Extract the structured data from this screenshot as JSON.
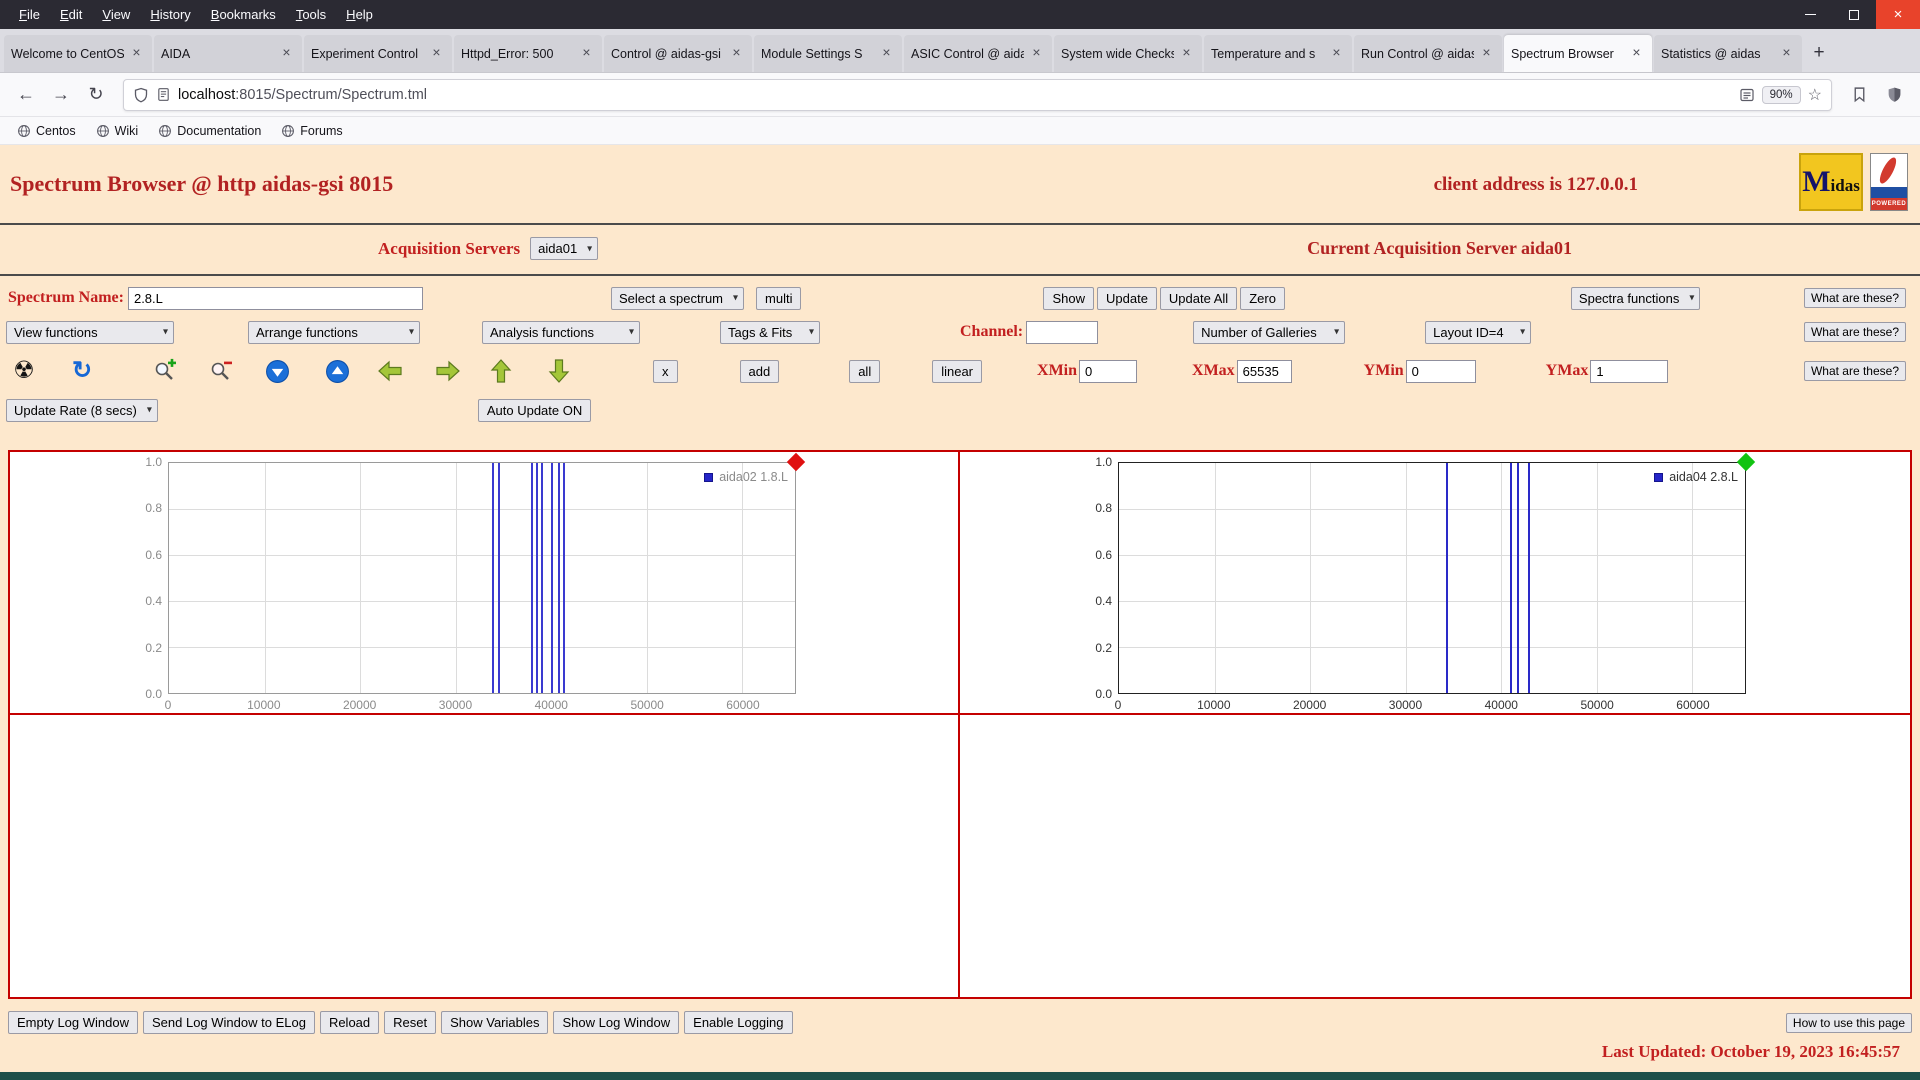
{
  "colors": {
    "page_bg": "#fde8cd",
    "heading_red": "#b22222",
    "label_red": "#c22020",
    "grid_border": "#c40000"
  },
  "glyphs": {
    "close": "×",
    "new_tab": "+",
    "back": "←",
    "forward": "→",
    "reload": "↻",
    "star": "☆",
    "radiation": "☢",
    "refresh": "↻"
  },
  "browser": {
    "menu_items": [
      "File",
      "Edit",
      "View",
      "History",
      "Bookmarks",
      "Tools",
      "Help"
    ],
    "tabs": [
      {
        "label": "Welcome to CentOS",
        "active": false
      },
      {
        "label": "AIDA",
        "active": false
      },
      {
        "label": "Experiment Control",
        "active": false
      },
      {
        "label": "Httpd_Error: 500",
        "active": false
      },
      {
        "label": "Control @ aidas-gsi",
        "active": false
      },
      {
        "label": "Module Settings S",
        "active": false
      },
      {
        "label": "ASIC Control @ aidas",
        "active": false
      },
      {
        "label": "System wide Checks",
        "active": false
      },
      {
        "label": "Temperature and s",
        "active": false
      },
      {
        "label": "Run Control @ aidas",
        "active": false
      },
      {
        "label": "Spectrum Browser",
        "active": true
      },
      {
        "label": "Statistics @ aidas",
        "active": false
      }
    ],
    "url": {
      "host": "localhost",
      "path": ":8015/Spectrum/Spectrum.tml"
    },
    "zoom_level": "90%",
    "bookmarks": [
      "Centos",
      "Wiki",
      "Documentation",
      "Forums"
    ]
  },
  "page": {
    "header": {
      "title": "Spectrum Browser @ http aidas-gsi 8015",
      "client_address": "client address is 127.0.0.1",
      "midas_logo_text": "Midas",
      "tcl_logo_text": "POWERED"
    },
    "acquisition": {
      "label": "Acquisition Servers",
      "selected": "aida01",
      "current": "Current Acquisition Server aida01"
    },
    "controls": {
      "spectrum_name_label": "Spectrum Name:",
      "spectrum_name_value": "2.8.L",
      "select_spectrum": "Select a spectrum",
      "multi": "multi",
      "show": "Show",
      "update": "Update",
      "update_all": "Update All",
      "zero": "Zero",
      "spectra_functions": "Spectra functions",
      "what_are_these": "What are these?",
      "view_functions": "View functions",
      "arrange_functions": "Arrange functions",
      "analysis_functions": "Analysis functions",
      "tags_fits": "Tags & Fits",
      "channel_label": "Channel:",
      "channel_value": "",
      "number_of_galleries": "Number of Galleries",
      "layout_id": "Layout ID=4",
      "x_button": "x",
      "add": "add",
      "all": "all",
      "linear": "linear",
      "xmin_label": "XMin",
      "xmin": "0",
      "xmax_label": "XMax",
      "xmax": "65535",
      "ymin_label": "YMin",
      "ymin": "0",
      "ymax_label": "YMax",
      "ymax": "1",
      "update_rate": "Update Rate (8 secs)",
      "auto_update": "Auto Update ON"
    },
    "footer": {
      "buttons": [
        "Empty Log Window",
        "Send Log Window to ELog",
        "Reload",
        "Reset",
        "Show Variables",
        "Show Log Window",
        "Enable Logging"
      ],
      "help_button": "How to use this page",
      "last_updated": "Last Updated: October 19, 2023 16:45:57"
    }
  },
  "chart_data": [
    {
      "type": "spectrum-lines",
      "legend": "aida02 1.8.L",
      "marker_color": "#e01010",
      "axis_color": "#9a9a9a",
      "tick_color": "#8a8a8a",
      "line_color": "#3a3ad0",
      "x_ticks": [
        0,
        10000,
        20000,
        30000,
        40000,
        50000,
        60000
      ],
      "y_ticks": [
        0,
        0.2,
        0.4,
        0.6,
        0.8,
        1.0
      ],
      "xlim": [
        0,
        65535
      ],
      "ylim": [
        0,
        1
      ],
      "lines": [
        33800,
        34450,
        37900,
        38450,
        38950,
        39950,
        40700,
        41250
      ]
    },
    {
      "type": "spectrum-lines",
      "legend": "aida04 2.8.L",
      "marker_color": "#12c312",
      "axis_color": "#222222",
      "tick_color": "#333333",
      "line_color": "#2a2ac8",
      "x_ticks": [
        0,
        10000,
        20000,
        30000,
        40000,
        50000,
        60000
      ],
      "y_ticks": [
        0,
        0.2,
        0.4,
        0.6,
        0.8,
        1.0
      ],
      "xlim": [
        0,
        65535
      ],
      "ylim": [
        0,
        1
      ],
      "lines": [
        34250,
        40900,
        41700,
        42850
      ]
    }
  ]
}
